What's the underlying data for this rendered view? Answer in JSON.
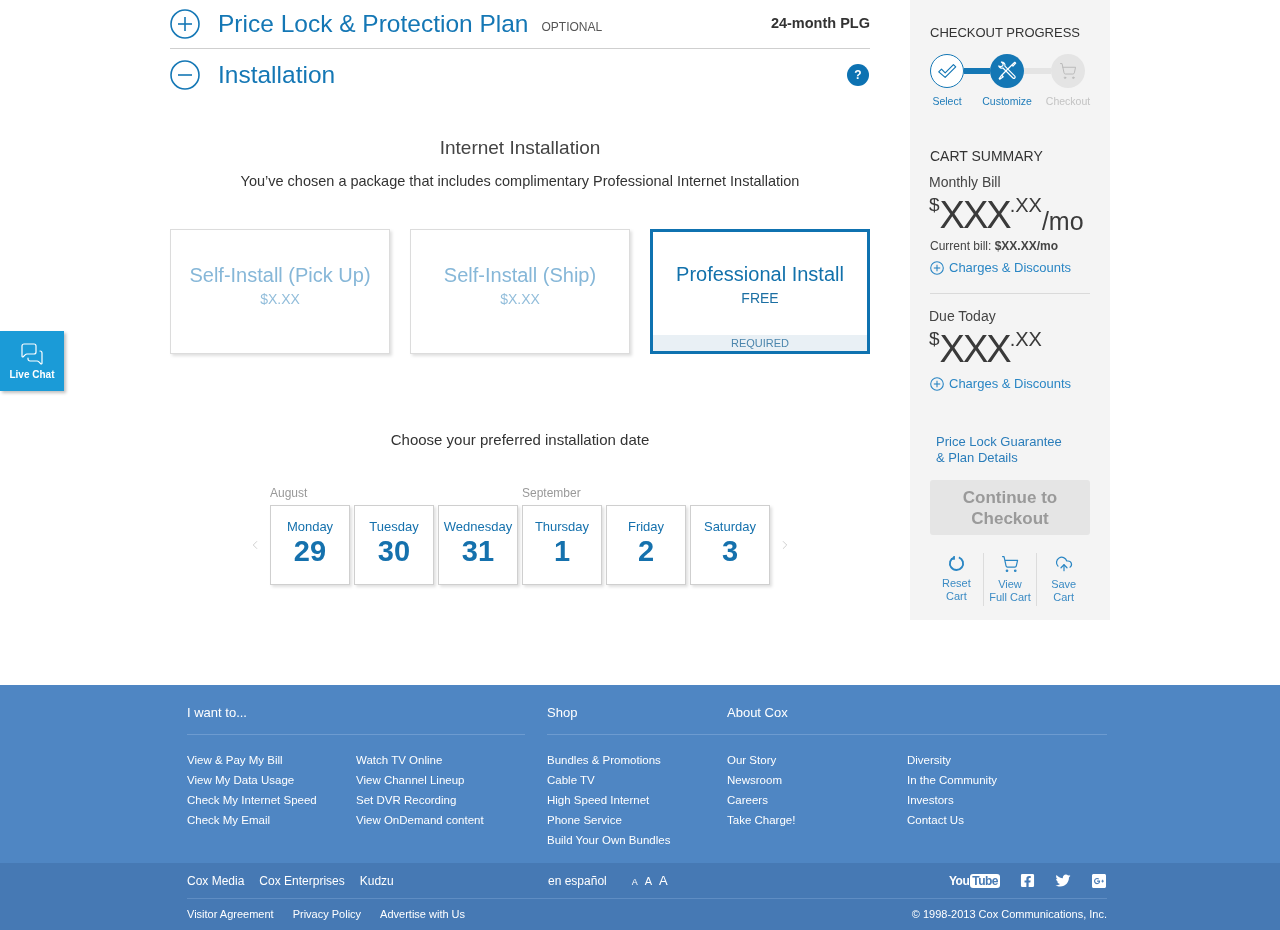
{
  "sections": [
    {
      "title": "Price Lock & Protection Plan",
      "tag": "OPTIONAL",
      "value": "24-month PLG",
      "expanded": false
    },
    {
      "title": "Installation",
      "help": "?",
      "expanded": true
    }
  ],
  "installation": {
    "title": "Internet Installation",
    "subtitle": "You’ve chosen a package that includes complimentary Professional Internet Installation",
    "options": [
      {
        "name": "Self-Install (Pick Up)",
        "price": "$X.XX",
        "selected": false
      },
      {
        "name": "Self-Install (Ship)",
        "price": "$X.XX",
        "selected": false
      },
      {
        "name": "Professional Install",
        "price": "FREE",
        "note": "REQUIRED",
        "selected": true
      }
    ]
  },
  "date_picker": {
    "prompt": "Choose your preferred installation date",
    "months": [
      {
        "label": "August",
        "days": [
          {
            "weekday": "Monday",
            "day": "29",
            "selected": false
          },
          {
            "weekday": "Tuesday",
            "day": "30",
            "selected": false
          },
          {
            "weekday": "Wednesday",
            "day": "31",
            "selected": false
          }
        ]
      },
      {
        "label": "September",
        "days": [
          {
            "weekday": "Thursday",
            "day": "1",
            "selected": false
          },
          {
            "weekday": "Friday",
            "day": "2",
            "selected": false
          },
          {
            "weekday": "Saturday",
            "day": "3",
            "selected": false
          }
        ]
      }
    ]
  },
  "live_chat": {
    "label": "Live Chat"
  },
  "sidebar": {
    "progress": {
      "title": "CHECKOUT PROGRESS",
      "steps": [
        {
          "label": "Select",
          "done": true
        },
        {
          "label": "Customize",
          "done": false
        },
        {
          "label": "Checkout",
          "done": false
        }
      ]
    },
    "cart_summary": {
      "title": "CART SUMMARY",
      "monthly": {
        "label": "Monthly Bill",
        "currency": "$",
        "amount": "XXX",
        "cents": ".XX",
        "period": "/mo",
        "current_bill": "Current bill: **$XX.XX/mo**",
        "link": "Charges & Discounts"
      },
      "due_today": {
        "label": "Due Today",
        "currency": "$",
        "amount": "XXX",
        "cents": ".XX",
        "link": "Charges & Discounts"
      }
    },
    "plan_link": "Price Lock Guarantee & Plan Details",
    "checkout_button": {
      "label": "Continue to Checkout",
      "disabled": true
    },
    "actions": [
      {
        "lines": [
          "Reset",
          "Cart"
        ]
      },
      {
        "lines": [
          "View",
          "Full Cart"
        ]
      },
      {
        "lines": [
          "Save",
          "Cart"
        ]
      }
    ]
  },
  "footer": {
    "groups": [
      {
        "heading": "I want to...",
        "columns": [
          [
            "View & Pay My Bill",
            "View My Data Usage",
            "Check My Internet Speed",
            "Check My Email"
          ],
          [
            "Watch TV Online",
            "View Channel Lineup",
            "Set DVR Recording",
            "View OnDemand content"
          ]
        ]
      },
      {
        "heading": "Shop",
        "columns": [
          [
            "Bundles & Promotions",
            "Cable TV",
            "High Speed Internet",
            "Phone Service",
            "Build Your Own Bundles"
          ]
        ]
      },
      {
        "heading": "About Cox",
        "columns": [
          [
            "Our Story",
            "Newsroom",
            "Careers",
            "Take Charge!"
          ],
          [
            "Diversity",
            "In the Community",
            "Investors",
            "Contact Us"
          ]
        ]
      }
    ],
    "company_links": [
      "Cox Media",
      "Cox Enterprises",
      "Kudzu"
    ],
    "language_link": "en español",
    "text_sizes": [
      {
        "label": "A",
        "kind": "small"
      },
      {
        "label": "A",
        "kind": "medium"
      },
      {
        "label": "A",
        "kind": "large"
      }
    ],
    "social": [
      {
        "kind": "youtube",
        "label": "You",
        "badge": "Tube"
      },
      {
        "kind": "facebook"
      },
      {
        "kind": "twitter"
      },
      {
        "kind": "google_plus"
      }
    ],
    "legal_links": [
      "Visitor Agreement",
      "Privacy Policy",
      "Advertise with Us"
    ],
    "copyright": "© 1998-2013 Cox Communications, Inc."
  }
}
